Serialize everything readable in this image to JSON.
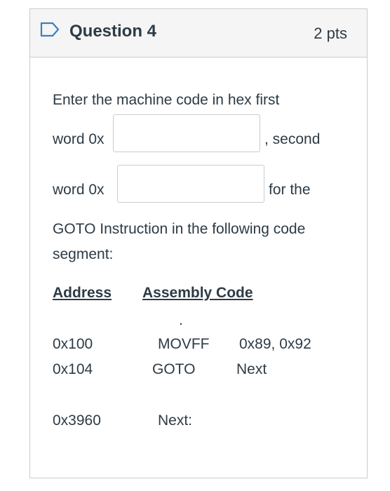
{
  "question": {
    "title": "Question 4",
    "points": "2 pts",
    "flag_icon": "bookmark-flag-icon"
  },
  "prompt": {
    "line1": "Enter the machine code in hex first",
    "first_prefix": "word 0x",
    "first_value": "",
    "first_suffix": ", second",
    "second_prefix": "word 0x",
    "second_value": "",
    "second_suffix": "for the",
    "line4": "GOTO Instruction in the following code",
    "line5": "segment:"
  },
  "code": {
    "address_header": "Address",
    "assembly_header": "Assembly Code",
    "ellipsis": ".",
    "rows": [
      {
        "address": "0x100",
        "instruction": "MOVFF",
        "operands": "0x89, 0x92"
      },
      {
        "address": "0x104",
        "instruction": "GOTO",
        "operands": "Next"
      },
      {
        "address": "0x3960",
        "instruction": "Next:",
        "operands": ""
      }
    ]
  },
  "colors": {
    "text": "#2d3b45",
    "border": "#c7cdd1",
    "header_bg": "#f5f5f5"
  }
}
